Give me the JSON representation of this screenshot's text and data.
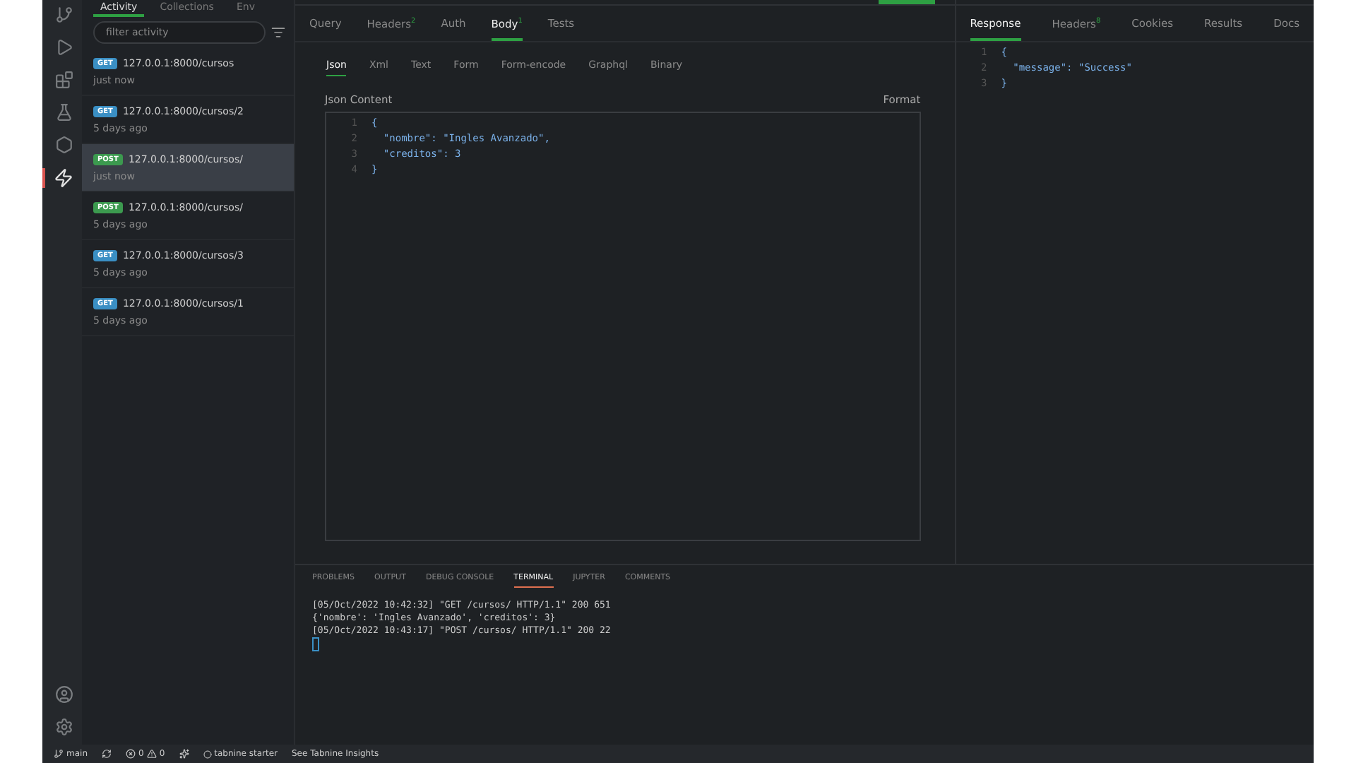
{
  "sidebar": {
    "tabs": [
      {
        "label": "Activity",
        "selected": true
      },
      {
        "label": "Collections",
        "selected": false
      },
      {
        "label": "Env",
        "selected": false
      }
    ],
    "filter": {
      "placeholder": "filter activity"
    },
    "items": [
      {
        "method": "GET",
        "url": "127.0.0.1:8000/cursos",
        "time": "just now",
        "selected": false
      },
      {
        "method": "GET",
        "url": "127.0.0.1:8000/cursos/2",
        "time": "5 days ago",
        "selected": false
      },
      {
        "method": "POST",
        "url": "127.0.0.1:8000/cursos/",
        "time": "just now",
        "selected": true
      },
      {
        "method": "POST",
        "url": "127.0.0.1:8000/cursos/",
        "time": "5 days ago",
        "selected": false
      },
      {
        "method": "GET",
        "url": "127.0.0.1:8000/cursos/3",
        "time": "5 days ago",
        "selected": false
      },
      {
        "method": "GET",
        "url": "127.0.0.1:8000/cursos/1",
        "time": "5 days ago",
        "selected": false
      }
    ]
  },
  "request": {
    "tabs": [
      {
        "label": "Query",
        "selected": false
      },
      {
        "label": "Headers",
        "count": "2",
        "selected": false
      },
      {
        "label": "Auth",
        "selected": false
      },
      {
        "label": "Body",
        "count": "1",
        "selected": true
      },
      {
        "label": "Tests",
        "selected": false
      }
    ],
    "body_tabs": [
      {
        "label": "Json",
        "selected": true
      },
      {
        "label": "Xml",
        "selected": false
      },
      {
        "label": "Text",
        "selected": false
      },
      {
        "label": "Form",
        "selected": false
      },
      {
        "label": "Form-encode",
        "selected": false
      },
      {
        "label": "Graphql",
        "selected": false
      },
      {
        "label": "Binary",
        "selected": false
      }
    ],
    "content_label": "Json Content",
    "format": "Format",
    "lines": [
      {
        "number": "1",
        "text": "{"
      },
      {
        "number": "2",
        "text": "  \"nombre\": \"Ingles Avanzado\","
      },
      {
        "number": "3",
        "text": "  \"creditos\": 3"
      },
      {
        "number": "4",
        "text": "}"
      }
    ]
  },
  "response": {
    "tabs": [
      {
        "label": "Response",
        "selected": true
      },
      {
        "label": "Headers",
        "count": "8",
        "selected": false
      },
      {
        "label": "Cookies",
        "selected": false
      },
      {
        "label": "Results",
        "selected": false
      },
      {
        "label": "Docs",
        "selected": false
      }
    ],
    "lines": [
      {
        "number": "1",
        "text": "{"
      },
      {
        "number": "2",
        "text": "  \"message\": \"Success\""
      },
      {
        "number": "3",
        "text": "}"
      }
    ]
  },
  "panel": {
    "tabs": [
      {
        "label": "PROBLEMS",
        "selected": false
      },
      {
        "label": "OUTPUT",
        "selected": false
      },
      {
        "label": "DEBUG CONSOLE",
        "selected": false
      },
      {
        "label": "TERMINAL",
        "selected": true
      },
      {
        "label": "JUPYTER",
        "selected": false
      },
      {
        "label": "COMMENTS",
        "selected": false
      }
    ],
    "terminal": [
      "[05/Oct/2022 10:42:32] \"GET /cursos/ HTTP/1.1\" 200 651",
      "{'nombre': 'Ingles Avanzado', 'creditos': 3}",
      "[05/Oct/2022 10:43:17] \"POST /cursos/ HTTP/1.1\" 200 22"
    ]
  },
  "status_bar": {
    "branch": "main",
    "errors": "0",
    "warnings": "0",
    "tabnine": "tabnine starter",
    "insights": "See Tabnine Insights"
  }
}
